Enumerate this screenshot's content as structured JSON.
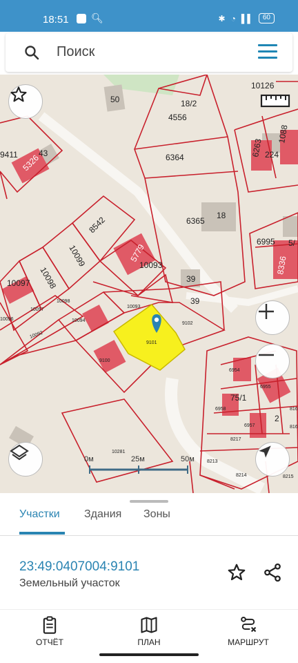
{
  "status": {
    "time": "18:51",
    "battery": "60"
  },
  "search": {
    "placeholder": "Поиск"
  },
  "map": {
    "labels": {
      "l50": "50",
      "l18_2": "18/2",
      "l4556": "4556",
      "l6364": "6364",
      "l9411": "9411",
      "l5326": "5326",
      "l43": "43",
      "l6263": "6263",
      "l224": "224",
      "l1088": "1088",
      "l10126": "10126",
      "l8542": "8542",
      "l6365": "6365",
      "l18": "18",
      "l6995": "6995",
      "l8336": "8336",
      "l10099": "10099",
      "l5779": "5779",
      "l10097": "10097",
      "l10098": "10098",
      "l10093": "10093",
      "l39a": "39",
      "l39b": "39",
      "l10096": "10096",
      "l10097s": "10097",
      "l10098s": "10098",
      "l10094": "10094",
      "l10093s": "10093",
      "l9102": "9102",
      "l9101": "9101",
      "l10092": "10092",
      "l9100": "9100",
      "l6954": "6954",
      "l6955": "6955",
      "l6958": "6958",
      "l6957": "6957",
      "l8217": "8217",
      "l8213": "8213",
      "l8214": "8214",
      "l8215": "8215",
      "l816a": "816",
      "l816b": "816",
      "l10281": "10281",
      "l75_1": "75/1",
      "l2": "2",
      "l5_": "5/"
    },
    "scale": {
      "s0": "0м",
      "s25": "25м",
      "s50": "50м"
    },
    "colors": {
      "selected_parcel": "#f7f01e",
      "boundary": "#c8202c",
      "building": "#e05a66",
      "background": "#ece6dc"
    }
  },
  "tabs": [
    {
      "label": "Участки"
    },
    {
      "label": "Здания"
    },
    {
      "label": "Зоны"
    }
  ],
  "parcel": {
    "id": "23:49:0407004:9101",
    "type": "Земельный участок"
  },
  "nav": [
    {
      "label": "ОТЧЁТ"
    },
    {
      "label": "ПЛАН"
    },
    {
      "label": "МАРШРУТ"
    }
  ]
}
